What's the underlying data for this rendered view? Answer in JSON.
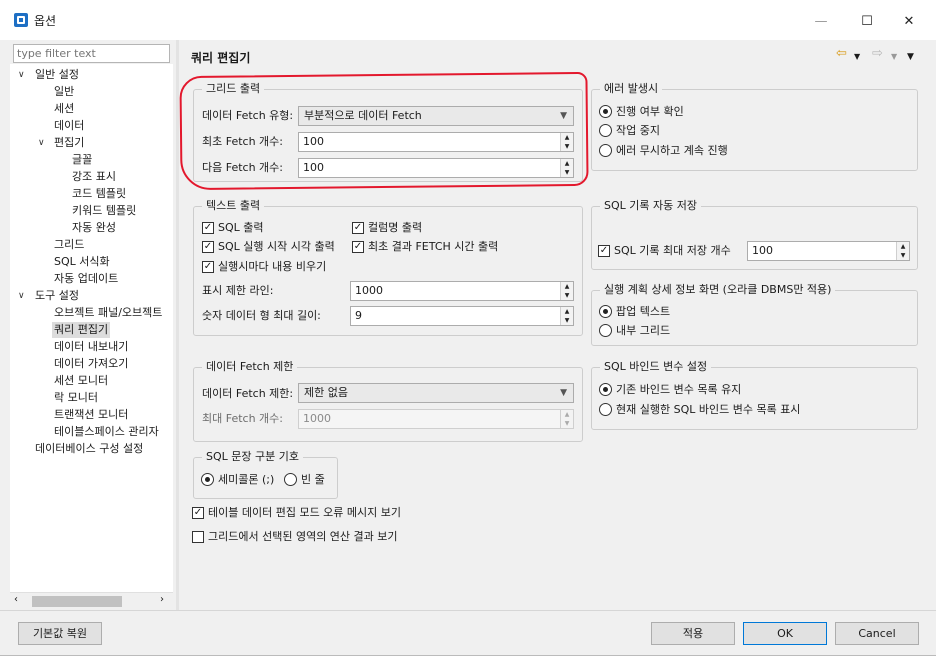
{
  "window": {
    "title": "옵션",
    "minimize": "—",
    "maximize": "☐",
    "close": "✕"
  },
  "filter": {
    "placeholder": "type filter text"
  },
  "tree": {
    "general": "일반 설정",
    "general_items": [
      "일반",
      "세션",
      "데이터"
    ],
    "editor": "편집기",
    "editor_items": [
      "글꼴",
      "강조 표시",
      "코드 템플릿",
      "키워드 템플릿",
      "자동 완성"
    ],
    "general_items2": [
      "그리드",
      "SQL 서식화",
      "자동 업데이트"
    ],
    "tools": "도구 설정",
    "tools_items": [
      "오브젝트 패널/오브젝트",
      "쿼리 편집기",
      "데이터 내보내기",
      "데이터 가져오기",
      "세션 모니터",
      "락 모니터",
      "트랜잭션 모니터",
      "테이블스페이스 관리자"
    ],
    "db_config": "데이터베이스 구성 설정",
    "selected": "쿼리 편집기"
  },
  "page": {
    "title": "쿼리 편집기"
  },
  "grid_output": {
    "title": "그리드 출력",
    "fetch_type_label": "데이터 Fetch 유형:",
    "fetch_type_value": "부분적으로 데이터 Fetch",
    "first_fetch_label": "최초 Fetch 개수:",
    "first_fetch_value": "100",
    "next_fetch_label": "다음 Fetch 개수:",
    "next_fetch_value": "100"
  },
  "error": {
    "title": "에러 발생시",
    "options": [
      "진행 여부 확인",
      "작업 중지",
      "에러 무시하고 계속 진행"
    ],
    "selected_index": 0
  },
  "text_output": {
    "title": "텍스트 출력",
    "sql_output": "SQL 출력",
    "column_output": "컬럼명 출력",
    "sql_start_time": "SQL 실행 시작 시각 출력",
    "first_result_time": "최초 결과 FETCH 시간 출력",
    "clear_each_run": "실행시마다 내용 비우기",
    "display_limit_label": "표시 제한 라인:",
    "display_limit_value": "1000",
    "numeric_width_label": "숫자 데이터 형 최대 길이:",
    "numeric_width_value": "9"
  },
  "sql_history": {
    "title": "SQL 기록 자동 저장",
    "max_label": "SQL 기록 최대 저장 개수",
    "max_value": "100"
  },
  "plan_view": {
    "title": "실행 계획 상세 정보 화면 (오라클 DBMS만 적용)",
    "options": [
      "팝업 텍스트",
      "내부 그리드"
    ],
    "selected_index": 0
  },
  "fetch_limit": {
    "title": "데이터 Fetch 제한",
    "limit_label": "데이터 Fetch 제한:",
    "limit_value": "제한 없음",
    "max_label": "최대 Fetch 개수:",
    "max_value": "1000"
  },
  "bind_vars": {
    "title": "SQL 바인드 변수 설정",
    "options": [
      "기존 바인드 변수 목록 유지",
      "현재 실행한 SQL 바인드 변수 목록 표시"
    ],
    "selected_index": 0
  },
  "separator": {
    "title": "SQL 문장 구분 기호",
    "options": [
      "세미콜론 (;)",
      "빈 줄"
    ],
    "selected_index": 0
  },
  "options_extra": {
    "table_edit_error": "테이블 데이터 편집 모드 오류 메시지 보기",
    "grid_selection_calc": "그리드에서 선택된 영역의 연산 결과 보기"
  },
  "buttons": {
    "restore_defaults": "기본값 복원",
    "apply": "적용",
    "ok": "OK",
    "cancel": "Cancel"
  },
  "colors": {
    "annotation": "#e3182d",
    "default_button_border": "#0078d7"
  }
}
